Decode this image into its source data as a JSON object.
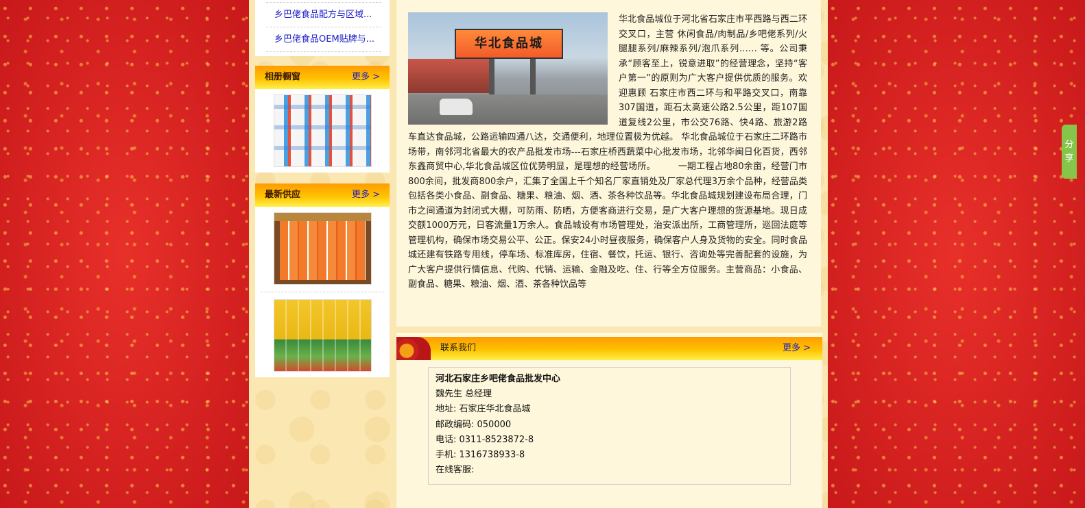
{
  "article_list": {
    "items": [
      "乡巴佬食品配方与区域...",
      "乡巴佬食品OEM贴牌与..."
    ]
  },
  "album": {
    "title": "相册橱窗",
    "more": "更多 >"
  },
  "supply": {
    "title": "最新供应",
    "more": "更多 >"
  },
  "intro": {
    "photo_sign": "华北食品城",
    "text": "华北食品城位于河北省石家庄市平西路与西二环交叉口，主营 休闲食品/肉制品/乡吧佬系列/火腿腿系列/麻辣系列/泡爪系列…… 等。公司秉承“顾客至上，锐意进取”的经营理念，坚持“客户第一”的原则为广大客户提供优质的服务。欢迎惠顾 石家庄市西二环与和平路交叉口，南靠307国道，距石太高速公路2.5公里，距107国道复线2公里，市公交76路、快4路、旅游2路车直达食品城，公路运输四通八达，交通便利，地理位置极为优越。 华北食品城位于石家庄二环路市场带，南邻河北省最大的农产品批发市场---石家庄桥西蔬菜中心批发市场，北邻华闽日化百货，西邻东鑫商贸中心,华北食品城区位优势明显，是理想的经营场所。　　　一期工程占地80余亩，经营门市800余间，批发商800余户，汇集了全国上千个知名厂家直销处及厂家总代理3万余个品种，经营品类包括各类小食品、副食品、糖果、粮油、烟、酒、茶各种饮品等。华北食品城规划建设布局合理，门市之间通道为封闭式大棚，可防雨、防晒，方便客商进行交易，是广大客户理想的货源基地。现日成交额1000万元，日客流量1万余人。食品城设有市场管理处，治安派出所，工商管理所，巡回法庭等管理机构，确保市场交易公平、公正。保安24小时昼夜服务，确保客户人身及货物的安全。同时食品城还建有铁路专用线，停车场、标准库房，住宿、餐饮，托运、银行、咨询处等完善配套的设施，为广大客户提供行情信息、代购、代销、运输、金融及吃、住、行等全方位服务。主营商品：小食品、副食品、糖果、粮油、烟、酒、茶各种饮品等"
  },
  "contact": {
    "title": "联系我们",
    "more": "更多 >",
    "company": "河北石家庄乡吧佬食品批发中心",
    "person": "魏先生 总经理",
    "address": "地址: 石家庄华北食品城",
    "postcode": "邮政编码: 050000",
    "phone": "电话: 0311-8523872-8",
    "mobile": "手机: 1316738933-8",
    "online": "在线客服:"
  },
  "share": {
    "label": "分享"
  },
  "colors": {
    "side_red": "#d8201d",
    "cream": "#fbe7b2",
    "title_orange": "#ff9c00",
    "link_blue": "#1a1ac8",
    "share_green": "#86c54a"
  }
}
